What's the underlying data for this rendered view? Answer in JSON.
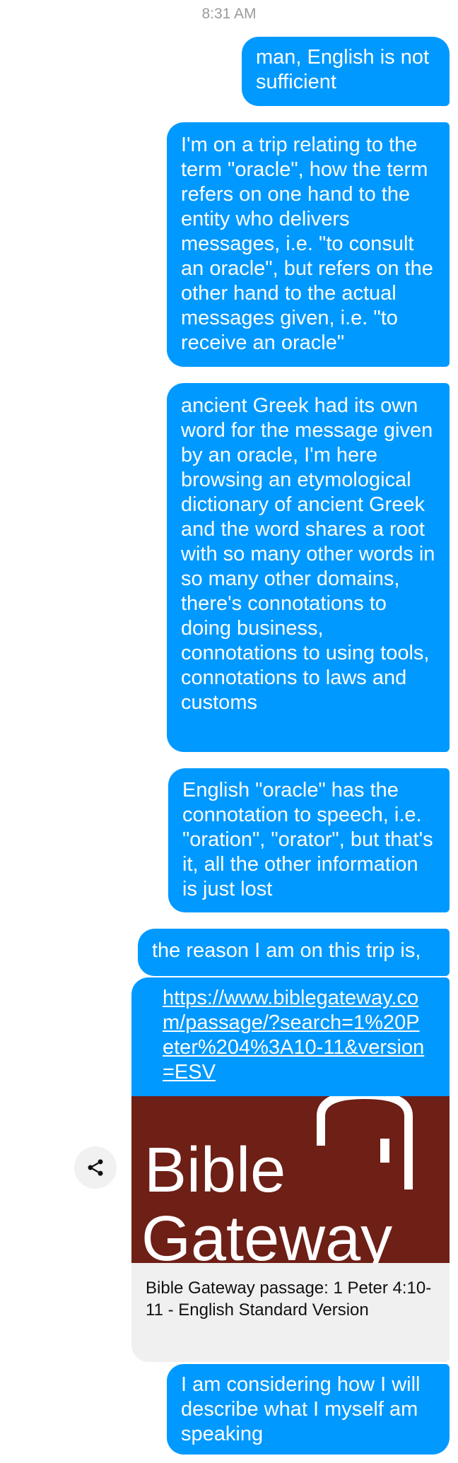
{
  "status": {
    "time": "8:31 AM"
  },
  "messages": [
    {
      "text": "man, English is not sufficient"
    },
    {
      "text": "I'm on a trip relating to the term \"oracle\", how the term refers on one hand to the entity who delivers messages, i.e. \"to consult an oracle\", but refers on the other hand to the actual messages given, i.e. \"to receive an oracle\""
    },
    {
      "text": "ancient Greek had its own word for the message given by an oracle, I'm here browsing an etymological dictionary of ancient Greek and the word shares a root with so many other words in so many other domains, there's connotations to doing business, connotations to using tools, connotations to laws and customs"
    },
    {
      "text": "English \"oracle\" has the connotation to speech, i.e. \"oration\", \"orator\", but that's it, all the other information is just lost"
    },
    {
      "text": "the reason I am on this trip is,"
    },
    {
      "text": "I am considering how I will describe what I myself am speaking"
    }
  ],
  "link_card": {
    "url": "https://www.biblegateway.com/passage/?search=1%20Peter%204%3A10-11&version=ESV",
    "logo_text_1": "Bible",
    "logo_text_2": "Gateway",
    "caption": "Bible Gateway passage: 1 Peter 4:10-11 - English Standard Version",
    "logo_bg": "#6e1f16"
  },
  "colors": {
    "bubble": "#0099ff",
    "bubble_text": "#ffffff",
    "timestamp": "#9b9b9b",
    "caption_bg": "#f0f0f0"
  },
  "icons": {
    "share": "share-icon"
  }
}
